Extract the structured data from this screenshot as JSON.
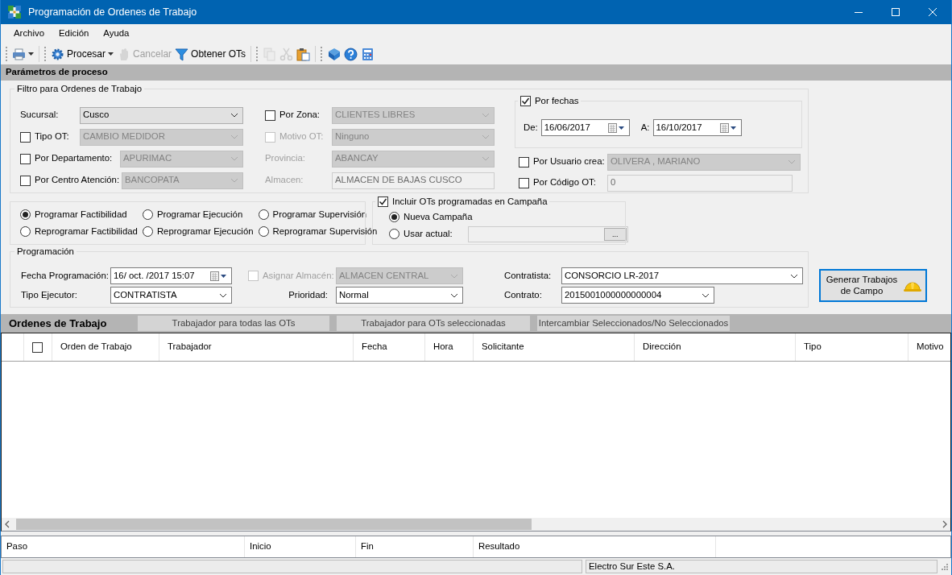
{
  "window": {
    "title": "Programación de Ordenes de Trabajo"
  },
  "menu": [
    {
      "label": "Archivo"
    },
    {
      "label": "Edición"
    },
    {
      "label": "Ayuda"
    }
  ],
  "toolbar": [
    {
      "kind": "printer",
      "dropdown": true,
      "disabled": false
    },
    {
      "kind": "separator"
    },
    {
      "kind": "gear",
      "label": "Procesar",
      "dropdown": true,
      "disabled": false
    },
    {
      "kind": "hand",
      "label": "Cancelar",
      "dropdown": false,
      "disabled": true
    },
    {
      "kind": "funnel",
      "label": "Obtener OTs",
      "dropdown": false,
      "disabled": false
    },
    {
      "kind": "separator"
    },
    {
      "kind": "copy",
      "dropdown": false,
      "disabled": true
    },
    {
      "kind": "cut",
      "dropdown": false,
      "disabled": true
    },
    {
      "kind": "paste",
      "dropdown": false,
      "disabled": false
    },
    {
      "kind": "separator"
    },
    {
      "kind": "book",
      "dropdown": false,
      "disabled": false
    },
    {
      "kind": "help",
      "dropdown": false,
      "disabled": false
    },
    {
      "kind": "calculator",
      "dropdown": false,
      "disabled": false
    }
  ],
  "section_title": "Parámetros de proceso",
  "filter": {
    "title": "Filtro para Ordenes de Trabajo",
    "columns": [
      [
        {
          "label": "Sucursal:",
          "label_disabled": false,
          "kind": "list",
          "value": "Cusco",
          "disabled": false
        },
        {
          "label": "Tipo OT:",
          "checked": false,
          "label_disabled": false,
          "kind": "list",
          "value": "CAMBIO MEDIDOR",
          "disabled": true
        },
        {
          "label": "Por Departamento:",
          "checked": false,
          "label_disabled": false,
          "kind": "list",
          "value": "APURIMAC",
          "disabled": true
        },
        {
          "label": "Por Centro Atención:",
          "checked": false,
          "label_disabled": false,
          "kind": "list",
          "value": "BANCOPATA",
          "disabled": true
        }
      ],
      [
        {
          "label": "Por Zona:",
          "checked": false,
          "label_disabled": false,
          "kind": "list",
          "value": "CLIENTES LIBRES",
          "disabled": true
        },
        {
          "label": "Motivo OT:",
          "checked": false,
          "label_disabled": true,
          "kind": "list",
          "value": "Ninguno",
          "disabled": true
        },
        {
          "label": "Provincia:",
          "label_disabled": true,
          "kind": "list",
          "value": "ABANCAY",
          "disabled": true
        },
        {
          "label": "Almacen:",
          "label_disabled": true,
          "kind": "text",
          "value": "ALMACEN DE BAJAS CUSCO",
          "disabled": true
        }
      ]
    ],
    "dates": {
      "label": "Por fechas",
      "checked": true,
      "from_label": "De:",
      "from": "16/06/2017",
      "to_label": "A:",
      "to": "16/10/2017"
    },
    "right": [
      {
        "label": "Por Usuario crea:",
        "checked": false,
        "label_disabled": false,
        "kind": "list",
        "value": "OLIVERA  , MARIANO",
        "disabled": true
      },
      {
        "label": "Por Código OT:",
        "checked": false,
        "label_disabled": false,
        "kind": "text",
        "value": "0",
        "disabled": true
      }
    ]
  },
  "modes": [
    {
      "label": "Programar Factibilidad",
      "selected": true
    },
    {
      "label": "Programar Ejecución",
      "selected": false
    },
    {
      "label": "Programar Supervisión",
      "selected": false
    },
    {
      "label": "Reprogramar Factibilidad",
      "selected": false
    },
    {
      "label": "Reprogramar Ejecución",
      "selected": false
    },
    {
      "label": "Reprogramar Supervisión",
      "selected": false
    }
  ],
  "campaign": {
    "label": "Incluir OTs programadas en Campaña",
    "checked": true,
    "options": [
      {
        "label": "Nueva Campaña",
        "selected": true
      },
      {
        "label": "Usar actual:",
        "selected": false
      }
    ],
    "browse": "..."
  },
  "programming": {
    "title": "Programación",
    "columns": [
      [
        {
          "label": "Fecha Programación:",
          "label_disabled": false,
          "kind": "date",
          "value": "16/ oct. /2017 15:07",
          "disabled": false
        },
        {
          "label": "Tipo Ejecutor:",
          "label_disabled": false,
          "kind": "combo",
          "value": "CONTRATISTA",
          "disabled": false
        }
      ],
      [
        {
          "label": "Asignar Almacén:",
          "checked": false,
          "label_disabled": true,
          "kind": "list",
          "value": "ALMACEN CENTRAL",
          "disabled": true
        },
        {
          "label": "Prioridad:",
          "label_disabled": false,
          "kind": "combo",
          "value": "Normal",
          "disabled": false
        }
      ],
      [
        {
          "label": "Contratista:",
          "label_disabled": false,
          "kind": "combo",
          "value": "CONSORCIO LR-2017",
          "disabled": false
        },
        {
          "label": "Contrato:",
          "label_disabled": false,
          "kind": "combo",
          "value": "2015001000000000004",
          "disabled": false
        }
      ]
    ]
  },
  "generate_button": "Generar Trabajos de Campo",
  "orders": {
    "title": "Ordenes de Trabajo",
    "actions": [
      "Trabajador para todas las OTs",
      "Trabajador para OTs seleccionadas",
      "Intercambiar Seleccionados/No Seleccionados"
    ],
    "select_all_checked": false,
    "columns": [
      "Orden de Trabajo",
      "Trabajador",
      "Fecha",
      "Hora",
      "Solicitante",
      "Dirección",
      "Tipo",
      "Motivo"
    ]
  },
  "log": {
    "columns": [
      "Paso",
      "Inicio",
      "Fin",
      "Resultado"
    ]
  },
  "status_bar": {
    "text": "Electro Sur Este S.A."
  }
}
